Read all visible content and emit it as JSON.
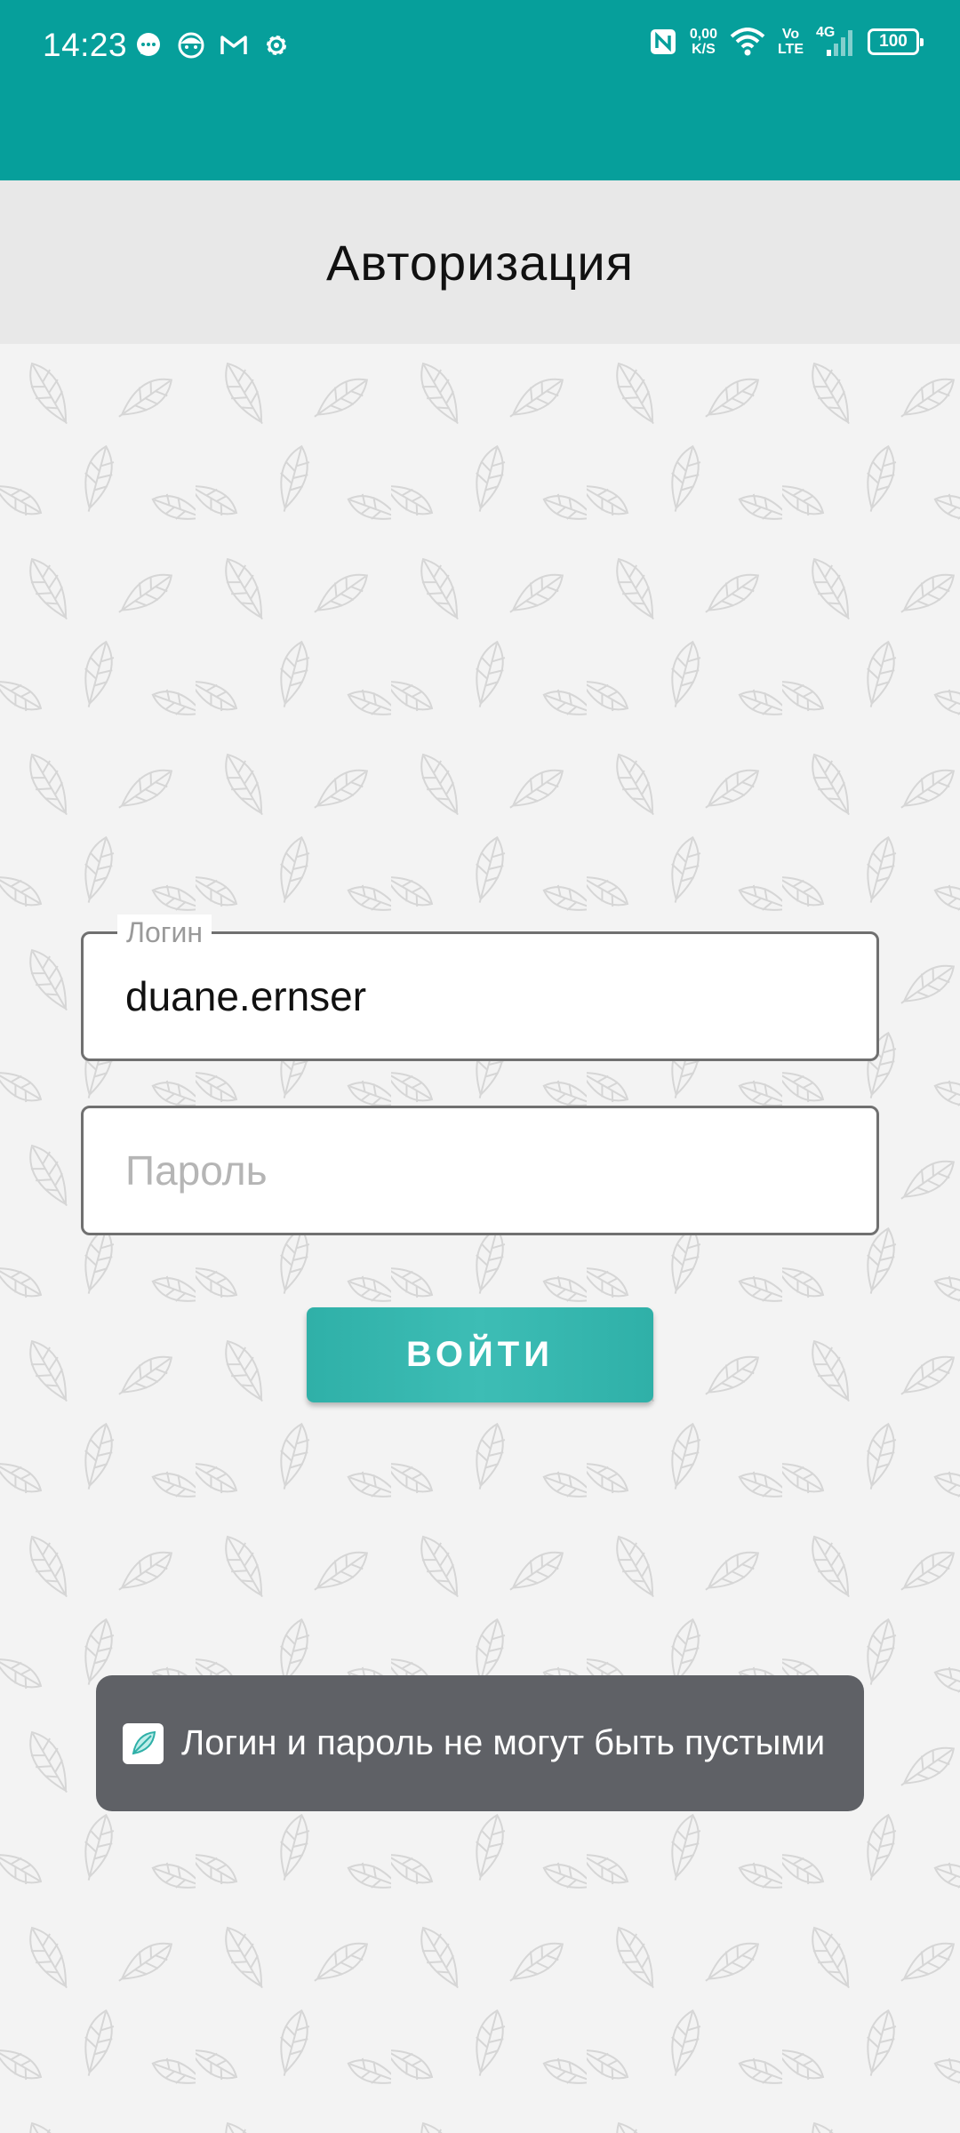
{
  "status_bar": {
    "time": "14:23",
    "left_icons": [
      "message-bubble-icon",
      "face-icon",
      "gmail-icon",
      "settings-gear-icon"
    ],
    "nfc_icon": "nfc-icon",
    "net_speed_value": "0,00",
    "net_speed_unit": "K/S",
    "wifi_icon": "wifi-icon",
    "volte_top": "Vo",
    "volte_bottom": "LTE",
    "network_type": "4G",
    "signal_icon": "signal-bars-icon",
    "battery_level": "100",
    "bar_color": "#069f9b"
  },
  "header": {
    "title": "Авторизация"
  },
  "form": {
    "login_label": "Логин",
    "login_value": "duane.ernser",
    "password_placeholder": "Пароль",
    "submit_label": "ВОЙТИ",
    "accent_color": "#35b5ad"
  },
  "toast": {
    "icon": "app-leaf-icon",
    "message": "Логин и пароль не могут быть пустыми"
  }
}
